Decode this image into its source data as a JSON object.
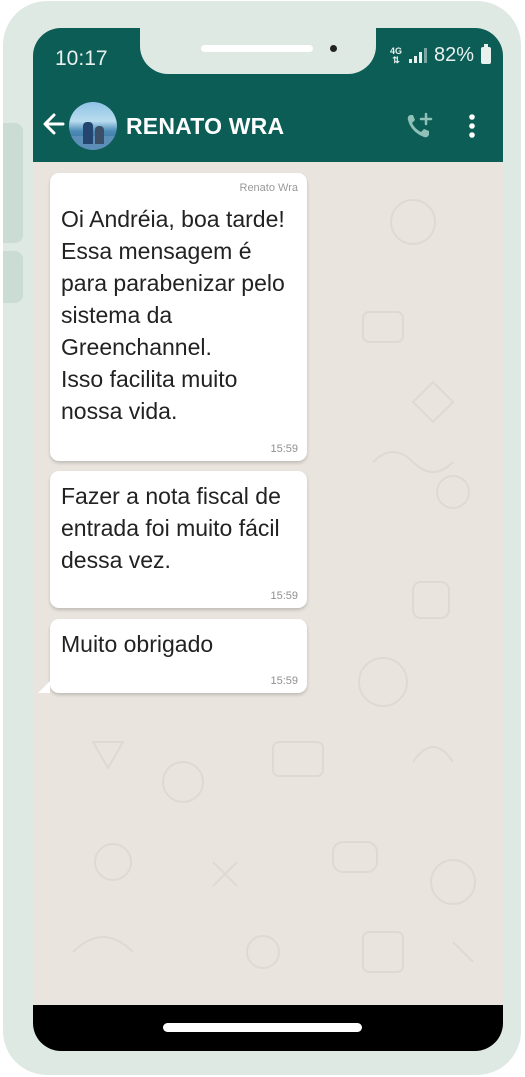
{
  "status_bar": {
    "time": "10:17",
    "network_label": "4G",
    "battery_percent": "82%"
  },
  "header": {
    "contact_name": "RENATO WRA",
    "icons": [
      "back-arrow-icon",
      "avatar",
      "add-call-icon",
      "more-vert-icon"
    ]
  },
  "messages": [
    {
      "sender": "Renato Wra",
      "text": "Oi Andréia, boa tarde!\nEssa mensagem é para parabenizar pelo sistema da Greenchannel.\nIsso facilita muito nossa vida.",
      "time": "15:59"
    },
    {
      "text": "Fazer a nota fiscal de entrada foi muito fácil dessa vez.",
      "time": "15:59"
    },
    {
      "text": "Muito obrigado",
      "time": "15:59"
    }
  ],
  "colors": {
    "header": "#0c5d55",
    "frame": "#dfe9e4",
    "chat_background": "#e9e4de",
    "bubble": "#ffffff"
  }
}
